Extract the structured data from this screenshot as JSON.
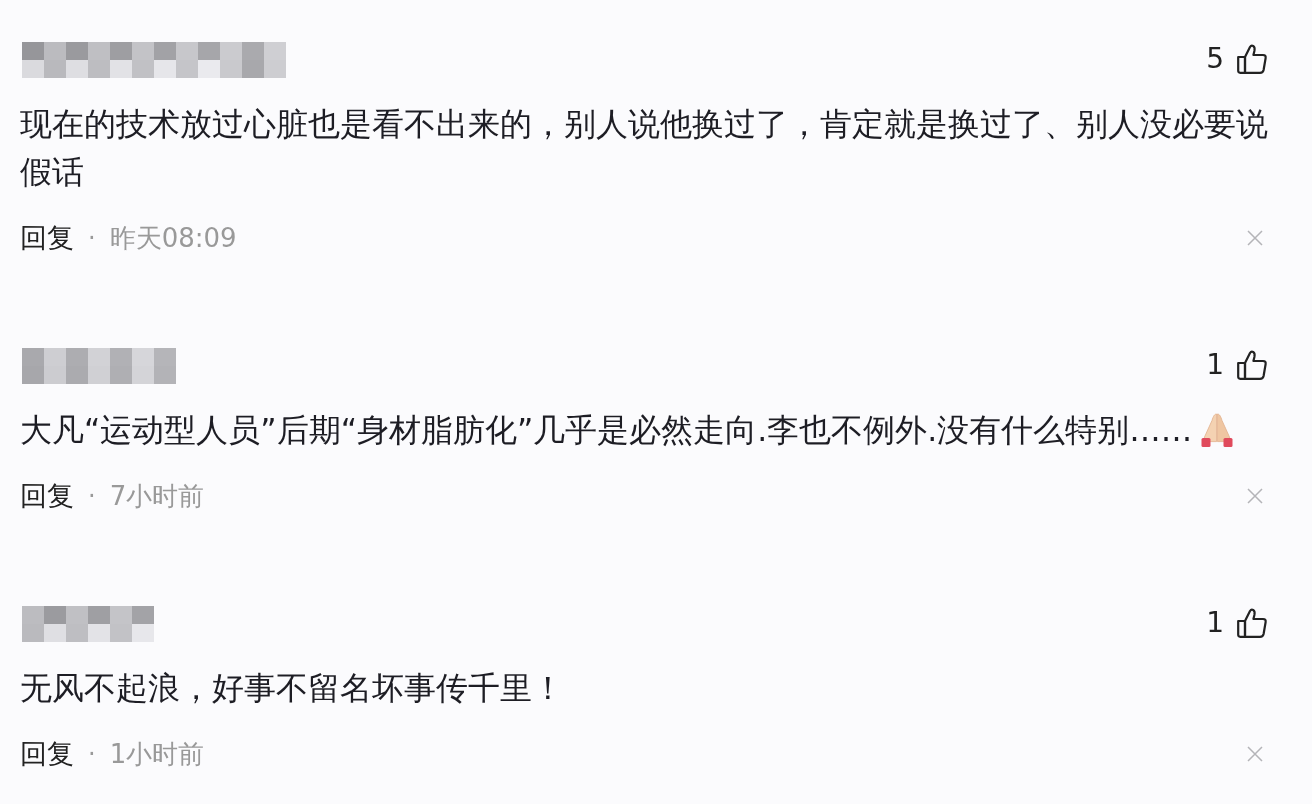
{
  "comments": [
    {
      "likes": "5",
      "text": "现在的技术放过心脏也是看不出来的，别人说他换过了，肯定就是换过了、别人没必要说假话",
      "ends_with_emoji": false,
      "reply": "回复",
      "dot": "·",
      "time": "昨天08:09"
    },
    {
      "likes": "1",
      "text": "大凡“运动型人员”后期“身材脂肪化”几乎是必然走向.李也不例外.没有什么特别……",
      "ends_with_emoji": true,
      "reply": "回复",
      "dot": "·",
      "time": "7小时前"
    },
    {
      "likes": "1",
      "text": "无风不起浪，好事不留名坏事传千里！",
      "ends_with_emoji": false,
      "reply": "回复",
      "dot": "·",
      "time": "1小时前"
    }
  ]
}
